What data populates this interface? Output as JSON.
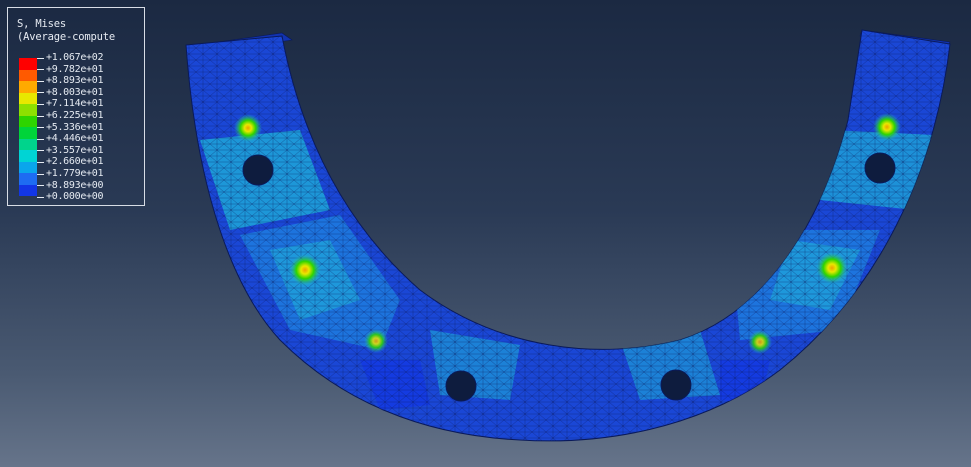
{
  "legend": {
    "title_line1": "S, Mises",
    "title_line2": "(Average-compute",
    "colors": [
      "#ff0000",
      "#ff5a00",
      "#ffaa00",
      "#e8e800",
      "#8ee000",
      "#2ed400",
      "#00d43a",
      "#00d48c",
      "#00d4d4",
      "#0aa6ec",
      "#1e6cf2",
      "#1236e6",
      "#0000d4"
    ],
    "labels": [
      "+1.067e+02",
      "+9.782e+01",
      "+8.893e+01",
      "+8.003e+01",
      "+7.114e+01",
      "+6.225e+01",
      "+5.336e+01",
      "+4.446e+01",
      "+3.557e+01",
      "+2.660e+01",
      "+1.779e+01",
      "+8.893e+00",
      "+0.000e+00"
    ]
  },
  "model": {
    "base_color": "#1a47d6",
    "mid_color": "#1e7fe0",
    "cyan_color": "#1fb1d8",
    "mesh_color": "#0a1a5a",
    "hole_color": "#0e1c3e",
    "hotspot_colors": [
      "#e8e800",
      "#2ed400",
      "#00d48c"
    ]
  }
}
